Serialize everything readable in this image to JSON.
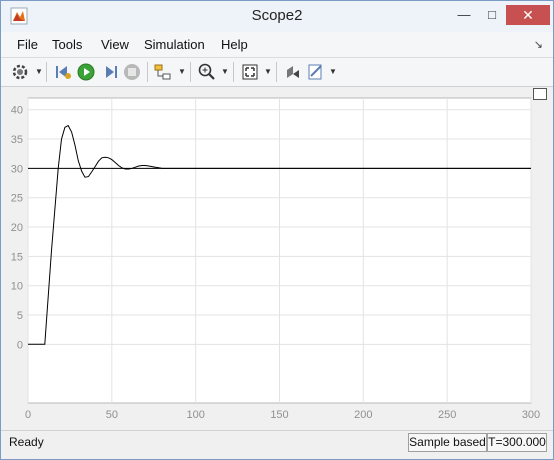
{
  "window": {
    "title": "Scope2"
  },
  "menubar": {
    "items": [
      "File",
      "Tools",
      "View",
      "Simulation",
      "Help"
    ]
  },
  "toolbar": {
    "icons": [
      "configuration-properties-icon",
      "step-back-icon",
      "run-icon",
      "step-forward-icon",
      "stop-icon",
      "highlight-block-icon",
      "zoom-in-icon",
      "fit-to-view-icon",
      "restore-view-icon",
      "style-icon"
    ]
  },
  "status": {
    "state": "Ready",
    "mode": "Sample based",
    "time": "T=300.000"
  },
  "colors": {
    "plot_bg": "#ffffff",
    "line": "#000000",
    "grid": "#e3e3e3",
    "tick_text": "#909090"
  },
  "chart_data": {
    "type": "line",
    "xlim": [
      0,
      300
    ],
    "ylim": [
      -10,
      42
    ],
    "xticks": [
      0,
      50,
      100,
      150,
      200,
      250,
      300
    ],
    "yticks": [
      0,
      5,
      10,
      15,
      20,
      25,
      30,
      35,
      40
    ],
    "grid": true,
    "series": [
      {
        "x": [
          0,
          10,
          14,
          18,
          20,
          22,
          24,
          26,
          28,
          30,
          32,
          34,
          36,
          38,
          40,
          42,
          44,
          46,
          48,
          50,
          52,
          54,
          56,
          58,
          60,
          62,
          64,
          66,
          68,
          70,
          72,
          74,
          76,
          78,
          80,
          84,
          88,
          92,
          300
        ],
        "y": [
          0,
          0,
          16,
          30,
          35,
          37,
          37.3,
          36.2,
          34,
          31.3,
          29.5,
          28.5,
          28.6,
          29.4,
          30.3,
          31.2,
          31.8,
          31.9,
          31.8,
          31.5,
          31,
          30.5,
          30.1,
          29.9,
          29.9,
          30,
          30.2,
          30.4,
          30.5,
          30.5,
          30.4,
          30.3,
          30.2,
          30.1,
          30,
          30,
          30,
          30,
          30
        ]
      },
      {
        "x": [
          0,
          300
        ],
        "y": [
          30,
          30
        ]
      }
    ]
  }
}
